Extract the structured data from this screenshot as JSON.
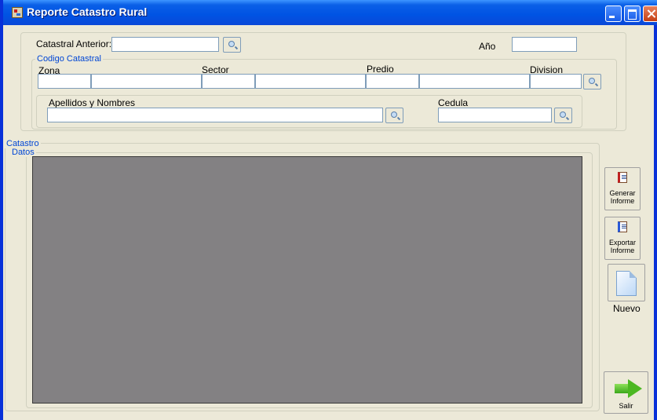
{
  "window": {
    "title": "Reporte Catastro Rural"
  },
  "search": {
    "catastral_anterior_label": "Catastral Anterior:",
    "anio_label": "Año",
    "codigo_catastral_legend": "Codigo Catastral",
    "zona_label": "Zona",
    "sector_label": "Sector",
    "predio_label": "Predio",
    "division_label": "Division",
    "apellidos_label": "Apellidos y Nombres",
    "cedula_label": "Cedula"
  },
  "catastro": {
    "legend": "Catastro",
    "datos_legend": "Datos"
  },
  "actions": {
    "generar_label_1": "Generar",
    "generar_label_2": "Informe",
    "exportar_label_1": "Exportar",
    "exportar_label_2": "Informe",
    "nuevo_label": "Nuevo",
    "salir_label": "Salir"
  },
  "icons": {
    "search": "search-icon",
    "generar": "report-icon",
    "exportar": "export-icon",
    "nuevo": "new-document-icon",
    "salir": "exit-arrow-icon"
  },
  "colors": {
    "titlebar": "#0053e3",
    "legend_text": "#0046d5",
    "grid_background": "#838183",
    "window_background": "#ece9d8"
  }
}
